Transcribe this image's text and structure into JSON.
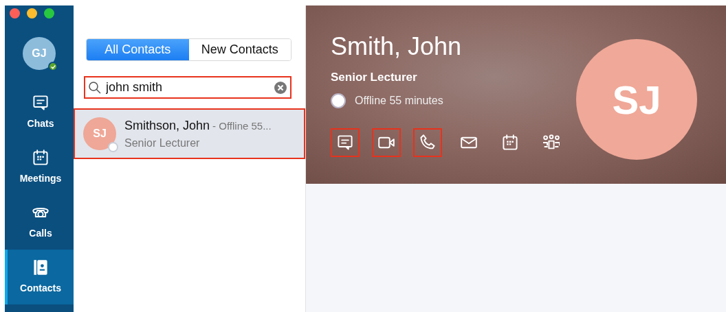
{
  "window_controls": [
    {
      "color": "#fc5f57"
    },
    {
      "color": "#fdbc2e"
    },
    {
      "color": "#28c840"
    }
  ],
  "user": {
    "initials": "GJ",
    "online": true
  },
  "nav": [
    {
      "kind": "chat",
      "label": "Chats",
      "selected": false
    },
    {
      "kind": "calendar",
      "label": "Meetings",
      "selected": false
    },
    {
      "kind": "phone",
      "label": "Calls",
      "selected": false
    },
    {
      "kind": "contacts",
      "label": "Contacts",
      "selected": true
    }
  ],
  "filter_tabs": [
    {
      "label": "All Contacts",
      "selected": true
    },
    {
      "label": "New Contacts",
      "selected": false
    }
  ],
  "search": {
    "value": "john smith",
    "highlighted": true
  },
  "results": [
    {
      "initials": "SJ",
      "name": "Smithson, John",
      "status_text": "- Offline 55...",
      "title": "Senior Lecturer",
      "online": false,
      "selected": true,
      "highlighted": true
    }
  ],
  "profile": {
    "name": "Smith, John",
    "title": "Senior Lecturer",
    "online": false,
    "status_text": "Offline 55 minutes",
    "initials": "SJ",
    "actions": [
      {
        "kind": "chat",
        "highlighted": true
      },
      {
        "kind": "video",
        "highlighted": true
      },
      {
        "kind": "phone",
        "highlighted": true
      },
      {
        "kind": "mail",
        "highlighted": false
      },
      {
        "kind": "calendar",
        "highlighted": false
      },
      {
        "kind": "people",
        "highlighted": false
      }
    ]
  }
}
